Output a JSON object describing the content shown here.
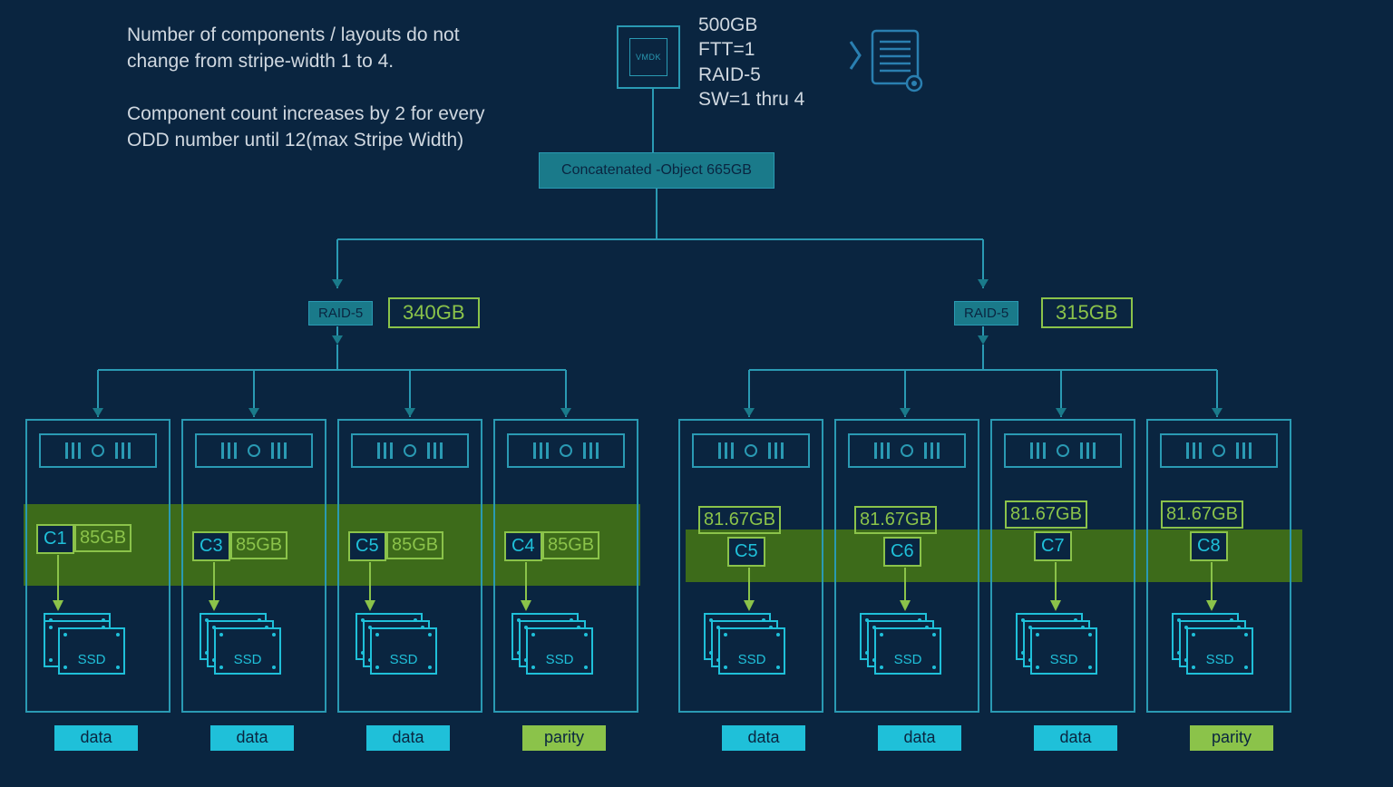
{
  "description": {
    "p1": "Number of components / layouts do not change from stripe-width 1 to 4.",
    "p2": "Component count increases by 2 for every ODD number until 12(max Stripe Width)"
  },
  "vmdk_label": "VMDK",
  "policy": {
    "line1": "500GB",
    "line2": "FTT=1",
    "line3": "RAID-5",
    "line4": "SW=1 thru 4"
  },
  "concat_label": "Concatenated -Object 665GB",
  "left_group": {
    "raid_label": "RAID-5",
    "size": "340GB",
    "hosts": [
      {
        "comp": "C1",
        "size": "85GB",
        "type": "data"
      },
      {
        "comp": "C3",
        "size": "85GB",
        "type": "data"
      },
      {
        "comp": "C5",
        "size": "85GB",
        "type": "data"
      },
      {
        "comp": "C4",
        "size": "85GB",
        "type": "parity"
      }
    ]
  },
  "right_group": {
    "raid_label": "RAID-5",
    "size": "315GB",
    "hosts": [
      {
        "comp": "C5",
        "size": "81.67GB",
        "type": "data"
      },
      {
        "comp": "C6",
        "size": "81.67GB",
        "type": "data"
      },
      {
        "comp": "C7",
        "size": "81.67GB",
        "type": "data"
      },
      {
        "comp": "C8",
        "size": "81.67GB",
        "type": "parity"
      }
    ]
  },
  "ssd_label": "SSD",
  "type_labels": {
    "data": "data",
    "parity": "parity"
  }
}
